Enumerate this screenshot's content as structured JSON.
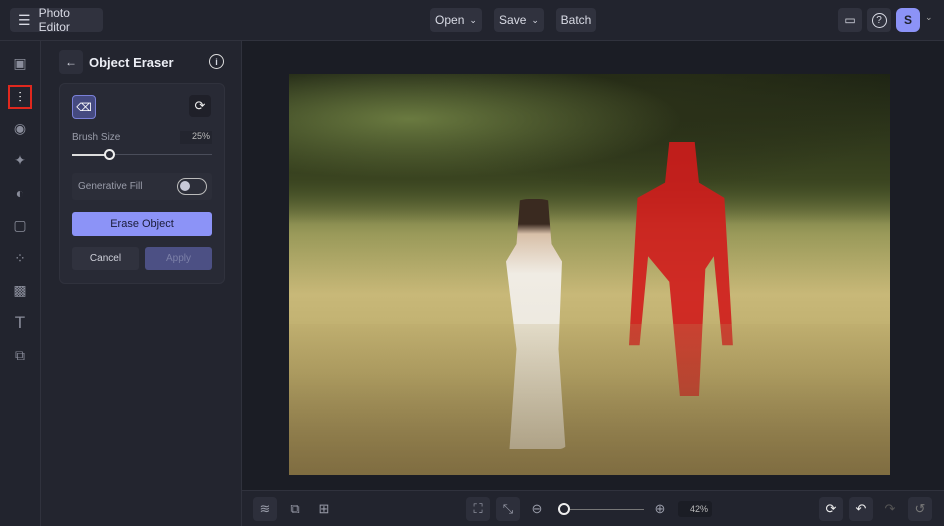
{
  "header": {
    "title": "Photo Editor",
    "open": "Open",
    "save": "Save",
    "batch": "Batch",
    "avatar": "S"
  },
  "panel": {
    "title": "Object Eraser",
    "brush_label": "Brush Size",
    "brush_value": "25%",
    "brush_fraction": 0.25,
    "gen_fill_label": "Generative Fill",
    "gen_fill_on": false,
    "erase": "Erase Object",
    "cancel": "Cancel",
    "apply": "Apply"
  },
  "zoom": {
    "value": "42%",
    "fraction": 0.05
  },
  "colors": {
    "accent": "#8c93f7",
    "mask": "#d01c1c"
  }
}
